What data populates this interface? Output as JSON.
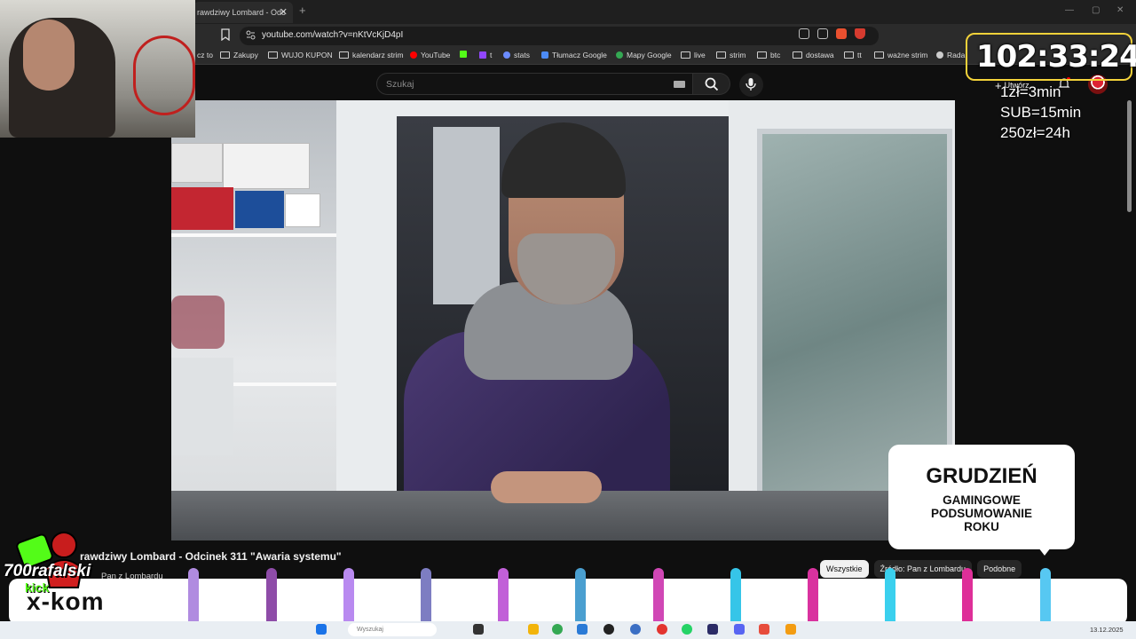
{
  "browser": {
    "tab_title": "rawdziwy Lombard - Odc",
    "url": "youtube.com/watch?v=nKtVcKjD4pI",
    "bookmarks": [
      {
        "label": "cz to"
      },
      {
        "label": "Zakupy"
      },
      {
        "label": "WUJO KUPON"
      },
      {
        "label": "kalendarz strim"
      },
      {
        "label": "YouTube"
      },
      {
        "label": "t"
      },
      {
        "label": "stats"
      },
      {
        "label": "Tłumacz Google"
      },
      {
        "label": "Mapy Google"
      },
      {
        "label": "live"
      },
      {
        "label": "strim"
      },
      {
        "label": "btc"
      },
      {
        "label": "dostawa"
      },
      {
        "label": "tt"
      },
      {
        "label": "ważne strim"
      },
      {
        "label": "Rada"
      }
    ]
  },
  "youtube": {
    "search_placeholder": "Szukaj",
    "create_label": "Utwórz",
    "video_title": "rawdziwy Lombard - Odcinek 311 \"Awaria systemu\"",
    "channel_name": "Pan z Lombardu",
    "chips": [
      "Wszystkie",
      "Źródło: Pan z Lombardu",
      "Podobne"
    ]
  },
  "stream_overlay": {
    "timer": "102:33:24",
    "rates": [
      "1zł=3min",
      "SUB=15min",
      "250zł=24h"
    ],
    "streamer_name": "700rafalski",
    "platform": "kick",
    "sponsor": "x-kom"
  },
  "promo": {
    "title": "GRUDZIEŃ",
    "subtitle_lines": [
      "GAMINGOWE",
      "PODSUMOWANIE",
      "ROKU"
    ]
  },
  "taskbar": {
    "search_placeholder": "Wyszukaj",
    "date": "13.12.2025"
  },
  "colors": {
    "timer_border": "#f3d23a",
    "kick_green": "#53fc18",
    "youtube_red": "#ff0000"
  }
}
